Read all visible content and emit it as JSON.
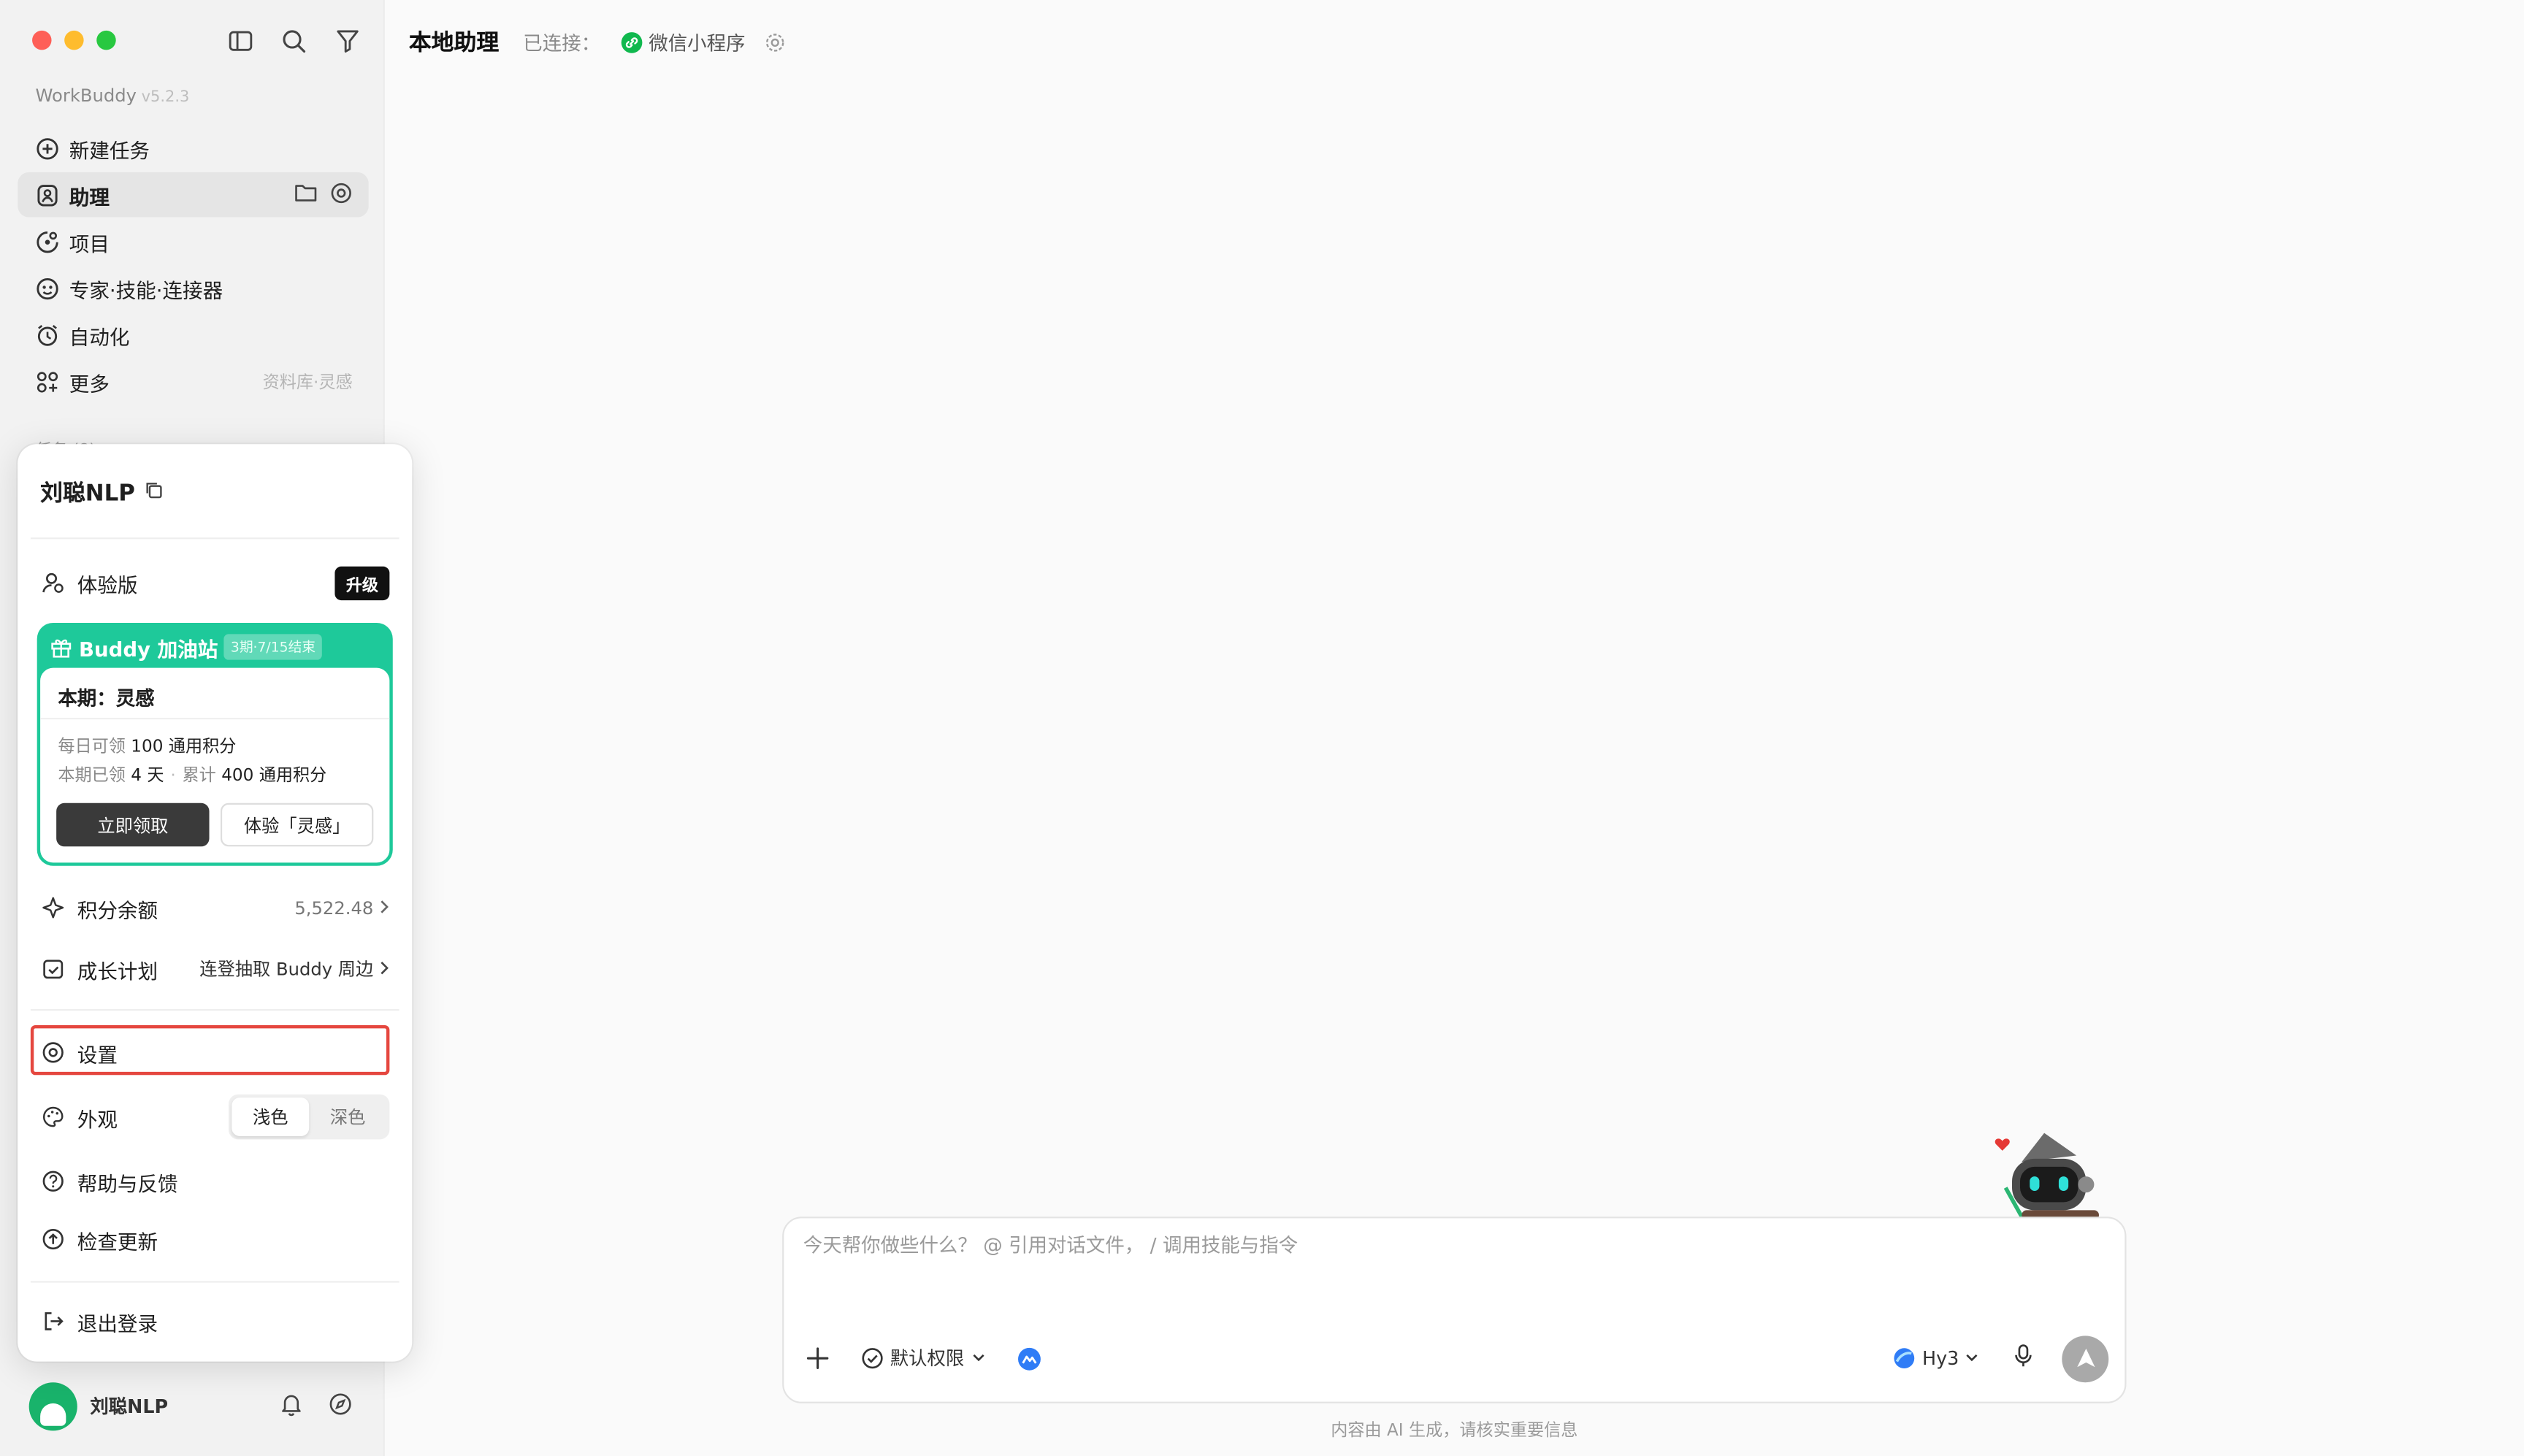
{
  "app": {
    "name": "WorkBuddy",
    "version": "v5.2.3"
  },
  "sidebar": {
    "items": [
      {
        "label": "新建任务"
      },
      {
        "label": "助理"
      },
      {
        "label": "项目"
      },
      {
        "label": "专家·技能·连接器"
      },
      {
        "label": "自动化"
      },
      {
        "label": "更多",
        "hint": "资料库·灵感"
      }
    ],
    "section_header": "任务 (8) ›"
  },
  "user": {
    "name": "刘聪NLP"
  },
  "menu": {
    "title": "刘聪NLP",
    "plan": {
      "label": "体验版",
      "upgrade": "升级"
    },
    "promo": {
      "title": "Buddy 加油站",
      "tag": "3期·7/15结束",
      "period": "本期：灵感",
      "daily_prefix": "每日可领",
      "daily_value": "100 通用积分",
      "claimed_prefix": "本期已领",
      "claimed_value": "4 天",
      "total_prefix": "累计",
      "total_value": "400 通用积分",
      "claim_button": "立即领取",
      "try_button": "体验「灵感」"
    },
    "points": {
      "label": "积分余额",
      "value": "5,522.48"
    },
    "growth": {
      "label": "成长计划",
      "value": "连登抽取 Buddy 周边"
    },
    "settings": "设置",
    "appearance": {
      "label": "外观",
      "light": "浅色",
      "dark": "深色"
    },
    "help": "帮助与反馈",
    "update": "检查更新",
    "logout": "退出登录"
  },
  "header": {
    "title": "本地助理",
    "connected_label": "已连接：",
    "channel": "微信小程序"
  },
  "composer": {
    "placeholder": "今天帮你做些什么？ @ 引用对话文件， / 调用技能与指令",
    "permission": "默认权限",
    "model": "Hy3"
  },
  "footer": "内容由 AI 生成，请核实重要信息",
  "colors": {
    "accent": "#1ec99a",
    "highlight": "#e5473f",
    "wechat": "#10b84e"
  }
}
